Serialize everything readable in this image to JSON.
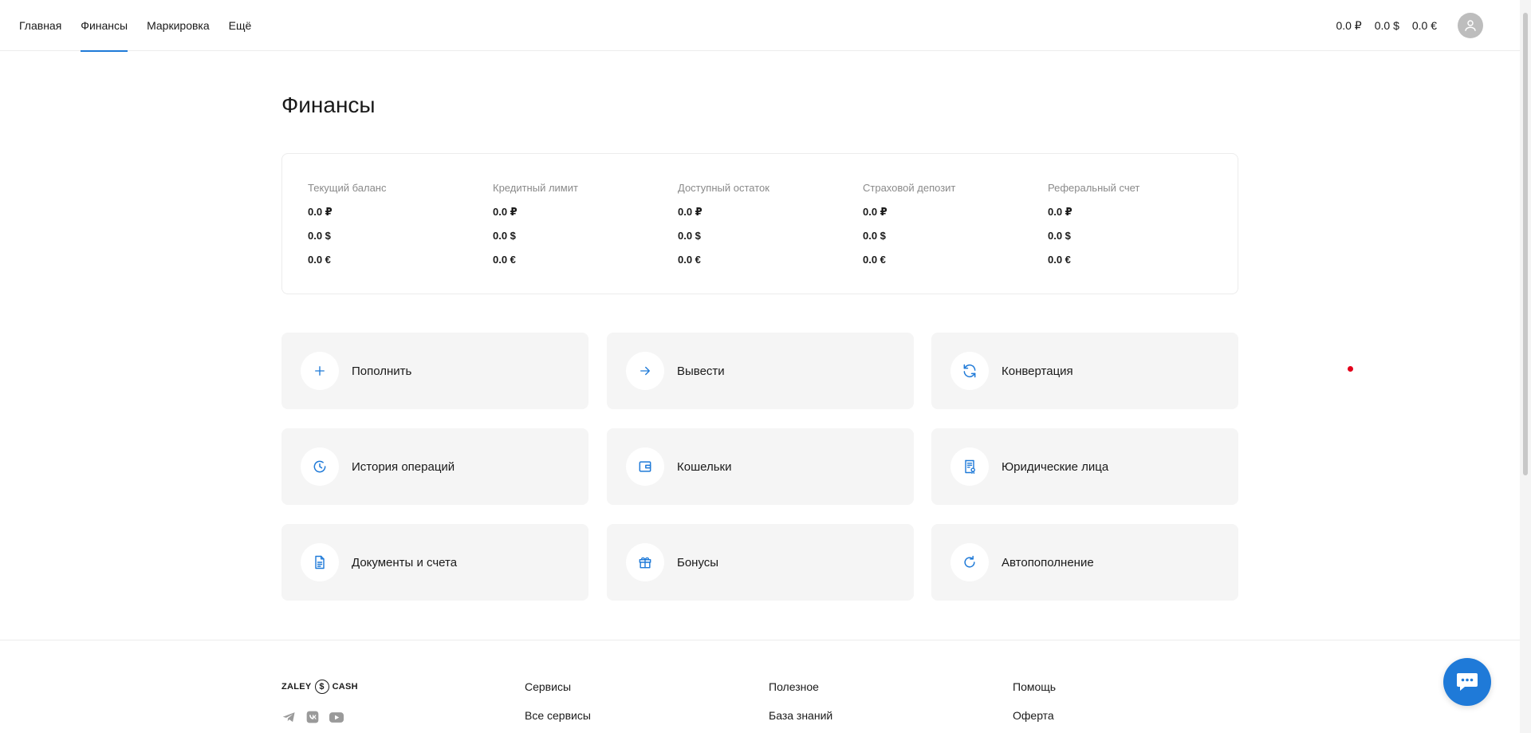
{
  "nav": {
    "items": [
      {
        "label": "Главная",
        "active": false
      },
      {
        "label": "Финансы",
        "active": true
      },
      {
        "label": "Маркировка",
        "active": false
      },
      {
        "label": "Ещё",
        "active": false
      }
    ]
  },
  "header_balances": {
    "rub": "0.0 ₽",
    "usd": "0.0 $",
    "eur": "0.0 €"
  },
  "page": {
    "title": "Финансы"
  },
  "balances": [
    {
      "label": "Текущий баланс",
      "rub": "0.0 ₽",
      "usd": "0.0 $",
      "eur": "0.0 €"
    },
    {
      "label": "Кредитный лимит",
      "rub": "0.0 ₽",
      "usd": "0.0 $",
      "eur": "0.0 €"
    },
    {
      "label": "Доступный остаток",
      "rub": "0.0 ₽",
      "usd": "0.0 $",
      "eur": "0.0 €"
    },
    {
      "label": "Страховой депозит",
      "rub": "0.0 ₽",
      "usd": "0.0 $",
      "eur": "0.0 €"
    },
    {
      "label": "Реферальный счет",
      "rub": "0.0 ₽",
      "usd": "0.0 $",
      "eur": "0.0 €"
    }
  ],
  "actions": [
    {
      "label": "Пополнить",
      "icon": "plus-icon"
    },
    {
      "label": "Вывести",
      "icon": "arrow-right-icon"
    },
    {
      "label": "Конвертация",
      "icon": "convert-icon"
    },
    {
      "label": "История операций",
      "icon": "history-icon"
    },
    {
      "label": "Кошельки",
      "icon": "wallet-icon"
    },
    {
      "label": "Юридические лица",
      "icon": "legal-entity-icon"
    },
    {
      "label": "Документы и счета",
      "icon": "document-icon"
    },
    {
      "label": "Бонусы",
      "icon": "gift-icon"
    },
    {
      "label": "Автопополнение",
      "icon": "auto-refill-icon"
    }
  ],
  "footer": {
    "logo_left": "ZALEY",
    "logo_coin": "$",
    "logo_right": "CASH",
    "columns": [
      {
        "heading": "Сервисы",
        "link": "Все сервисы"
      },
      {
        "heading": "Полезное",
        "link": "База знаний"
      },
      {
        "heading": "Помощь",
        "link": "Оферта"
      }
    ],
    "socials": [
      "telegram-icon",
      "vk-icon",
      "youtube-icon"
    ]
  },
  "colors": {
    "accent": "#1f7ad8",
    "tile_bg": "#f5f5f5",
    "muted_text": "#8a8a8a",
    "dot": "#e3001b"
  }
}
